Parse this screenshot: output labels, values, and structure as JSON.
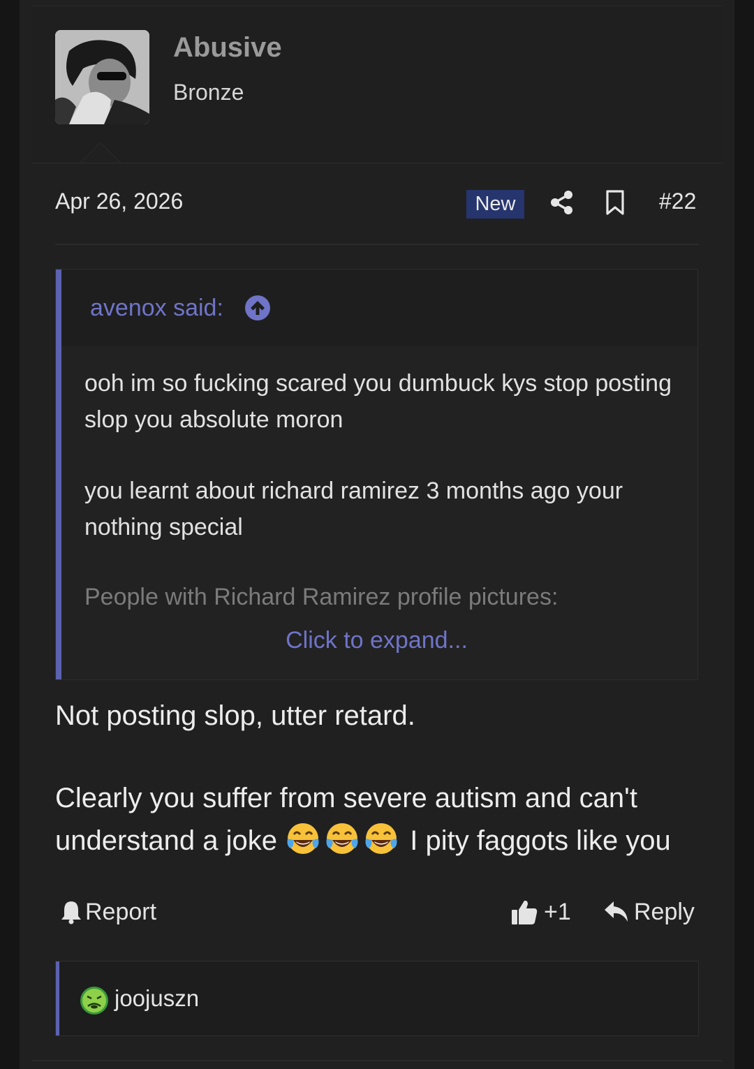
{
  "author": {
    "username": "Abusive",
    "user_title": "Bronze",
    "avatar": "user-avatar-photo"
  },
  "post": {
    "date": "Apr 26, 2026",
    "badge": "New",
    "number": "#22",
    "icons": [
      "share-icon",
      "bookmark-icon"
    ]
  },
  "quote": {
    "author": "avenox said:",
    "lines": [
      "ooh im so fucking scared you dumbuck kys stop posting slop you absolute moron",
      "you learnt about richard ramirez 3 months ago your nothing special"
    ],
    "faded_line": "People with Richard Ramirez profile pictures:",
    "expand_label": "Click to expand..."
  },
  "body": {
    "line1": "Not posting slop, utter retard.",
    "line2_part1": "Clearly you suffer from severe autism and can't",
    "line2_part2": "understand a joke",
    "line2_part3": "I pity faggots like you",
    "emojis": [
      "face-with-tears-of-joy",
      "face-with-tears-of-joy",
      "face-with-tears-of-joy"
    ]
  },
  "actions": {
    "report_label": "Report",
    "like_count": "+1",
    "reply_label": "Reply"
  },
  "reactions": {
    "icon": "nauseated-face-icon",
    "users": "joojuszn"
  },
  "colors": {
    "accent": "#6f74c8",
    "quote_bar": "#5c62b0",
    "badge_bg": "#26356e",
    "page_bg": "#202020"
  }
}
